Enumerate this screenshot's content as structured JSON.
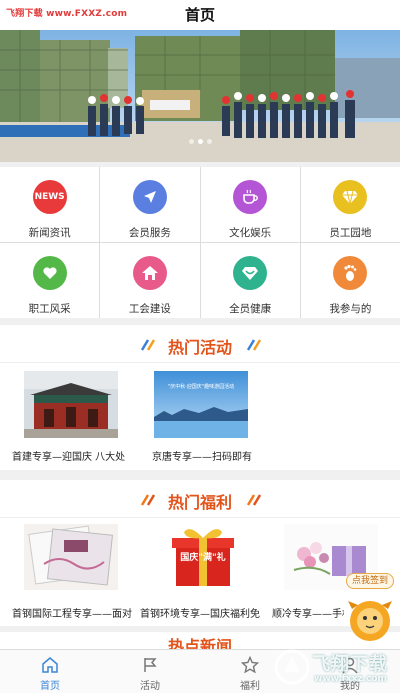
{
  "watermark_top": "飞翔下载 www.FXXZ.com",
  "header": {
    "title": "首页"
  },
  "banner": {
    "dot_count": 3,
    "active_dot": 1
  },
  "menu": [
    {
      "label": "新闻资讯",
      "icon": "news-icon",
      "color": "#e83a3a",
      "icon_text": "NEWS"
    },
    {
      "label": "会员服务",
      "icon": "navigation-arrow-icon",
      "color": "#5b7fe0"
    },
    {
      "label": "文化娱乐",
      "icon": "coffee-cup-icon",
      "color": "#b455d6"
    },
    {
      "label": "员工园地",
      "icon": "diamond-icon",
      "color": "#e8c020"
    },
    {
      "label": "职工风采",
      "icon": "heart-icon",
      "color": "#54b848"
    },
    {
      "label": "工会建设",
      "icon": "house-icon",
      "color": "#e85a8a"
    },
    {
      "label": "全员健康",
      "icon": "health-diamond-icon",
      "color": "#2fb38f"
    },
    {
      "label": "我参与的",
      "icon": "footprint-icon",
      "color": "#f08a3a"
    }
  ],
  "hot_activities": {
    "title": "热门活动",
    "items": [
      {
        "caption": "首建专享—迎国庆 八大处",
        "image": "temple-photo"
      },
      {
        "caption": "京唐专享——扫码即有",
        "image": "lake-poster",
        "poster_text": "\"庆中秋·迎国庆\"趣味游园活动"
      }
    ]
  },
  "hot_benefits": {
    "title": "热门福利",
    "items": [
      {
        "caption": "首钢国际工程专享——面对",
        "image": "notebook-photo"
      },
      {
        "caption": "首钢环境专享—国庆福利免",
        "image": "gift-box-photo",
        "poster_text": "国庆\"满\"礼"
      },
      {
        "caption": "顺冷专享——手机洼",
        "image": "flower-gift-photo"
      }
    ]
  },
  "hot_news": {
    "title": "热点新闻"
  },
  "sign_in": {
    "label": "点我签到"
  },
  "tabbar": [
    {
      "label": "首页",
      "icon": "home-icon",
      "active": true
    },
    {
      "label": "活动",
      "icon": "flag-icon",
      "active": false
    },
    {
      "label": "福利",
      "icon": "star-icon",
      "active": false
    },
    {
      "label": "我的",
      "icon": "person-icon",
      "active": false
    }
  ],
  "watermark_bottom": {
    "text": "飞翔下载",
    "url": "www.fxxz.com"
  },
  "colors": {
    "accent": "#e3541c",
    "tab_active": "#3a86d8",
    "bg": "#f0f0f0"
  }
}
